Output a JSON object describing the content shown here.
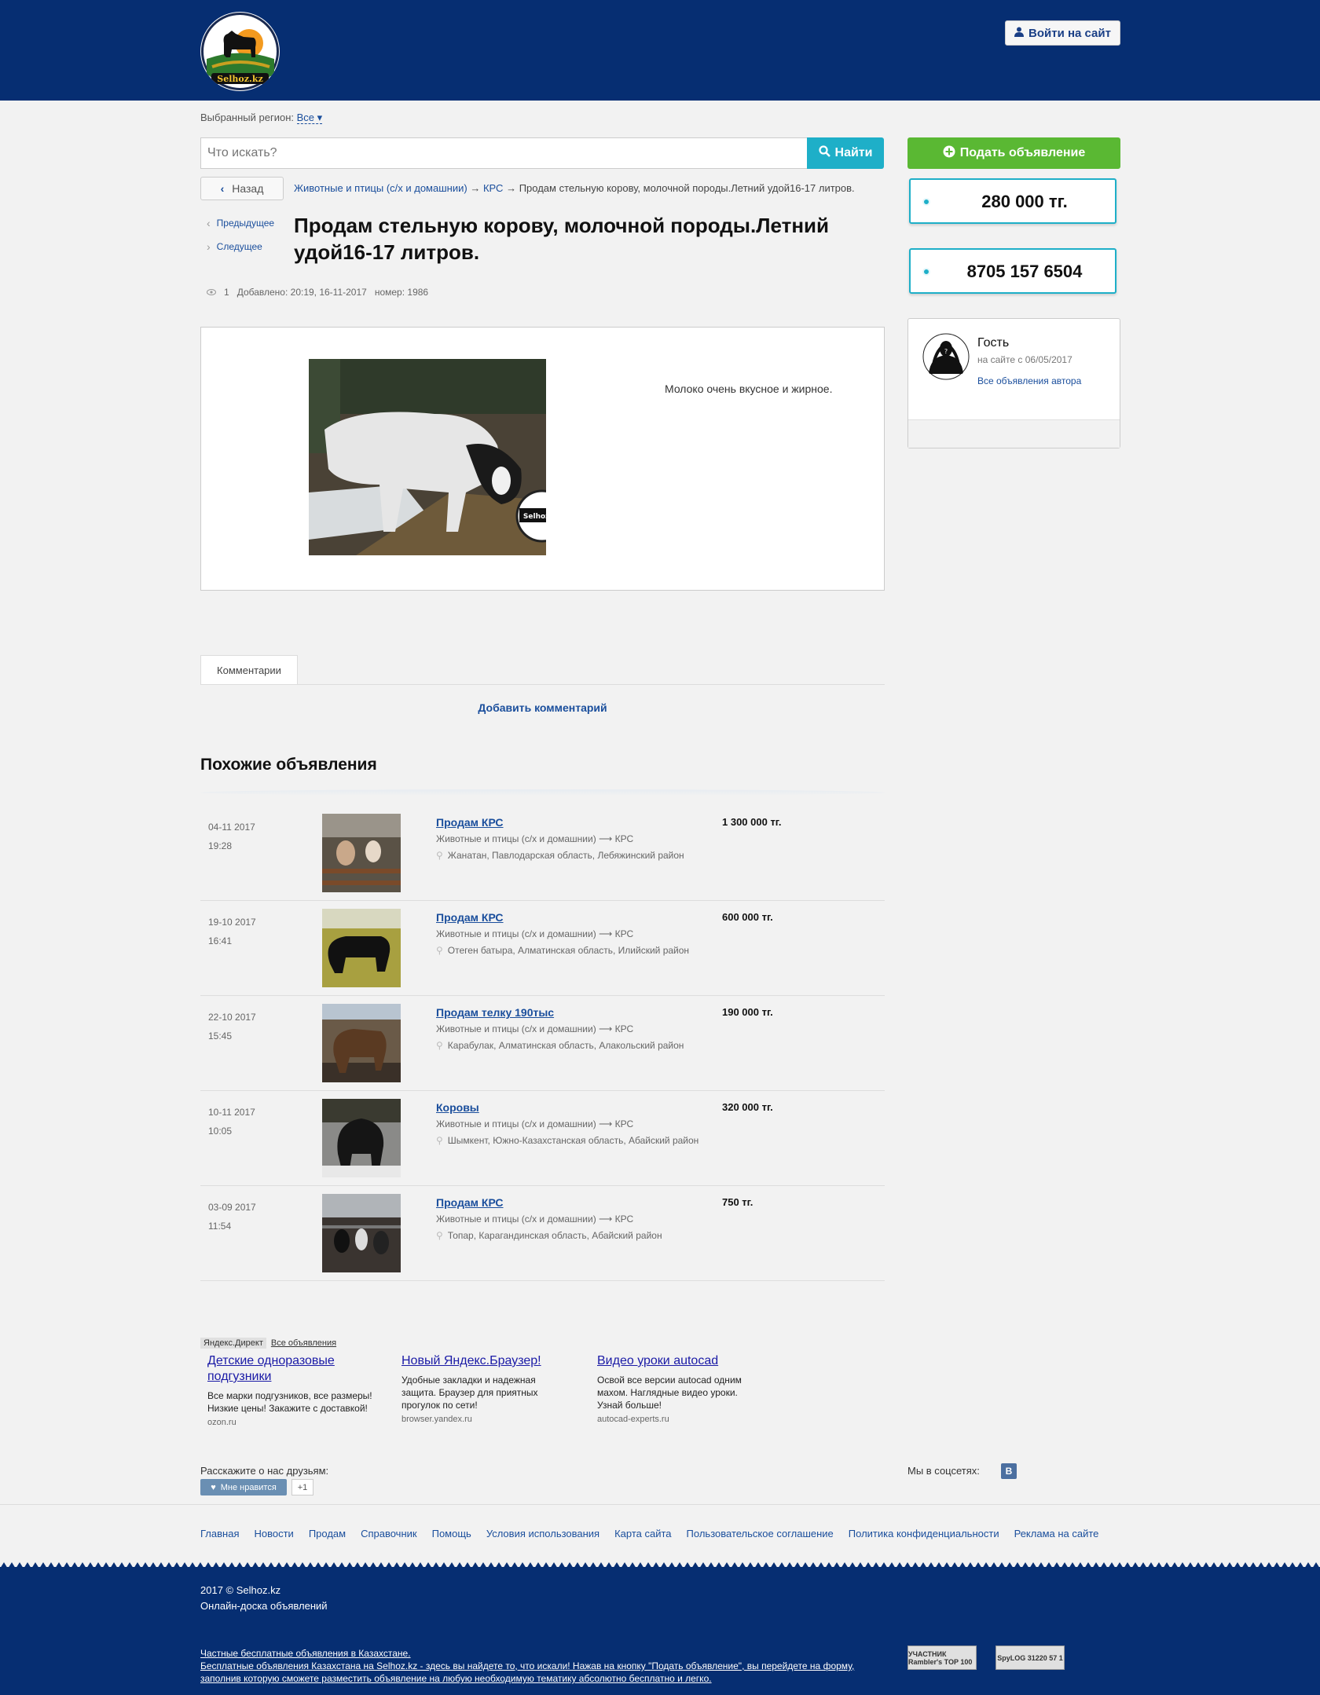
{
  "header": {
    "logo_text": "Selhoz.kz",
    "login_label": "Войти на сайт"
  },
  "region": {
    "label": "Выбранный регион:",
    "value": "Все"
  },
  "search": {
    "placeholder": "Что искать?",
    "button_label": "Найти"
  },
  "post_ad_label": "Подать объявление",
  "back_label": "Назад",
  "breadcrumb": {
    "level1": "Животные и птицы (с/х и домашнии)",
    "sep": "→",
    "level2": "КРС",
    "current": "Продам стельную корову, молочной породы.Летний удой16-17 литров."
  },
  "nav": {
    "prev": "Предыдущее",
    "next": "Следущее"
  },
  "listing": {
    "title": "Продам стельную корову, молочной породы.Летний удой16-17 литров.",
    "views": "1",
    "added": "Добавлено: 20:19, 16-11-2017",
    "number": "номер: 1986",
    "description": "Молоко очень вкусное и жирное.",
    "watermark": "Selhoz.kz",
    "price": "280 000 тг.",
    "phone": "8705 157 6504"
  },
  "author": {
    "name": "Гость",
    "since": "на сайте с 06/05/2017",
    "all_ads": "Все объявления автора"
  },
  "comments": {
    "tab": "Комментарии",
    "add": "Добавить комментарий"
  },
  "similar": {
    "title": "Похожие объявления",
    "items": [
      {
        "date": "04-11 2017",
        "time": "19:28",
        "title": "Продам КРС",
        "category": "Животные и птицы (с/х и домашнии) ⟶ КРС",
        "location": "Жанатан, Павлодарская область, Лебяжинский район",
        "price": "1 300 000 тг."
      },
      {
        "date": "19-10 2017",
        "time": "16:41",
        "title": "Продам КРС",
        "category": "Животные и птицы (с/х и домашнии) ⟶ КРС",
        "location": "Отеген батыра, Алматинская область, Илийский район",
        "price": "600 000 тг."
      },
      {
        "date": "22-10 2017",
        "time": "15:45",
        "title": "Продам телку 190тыс",
        "category": "Животные и птицы (с/х и домашнии) ⟶ КРС",
        "location": "Карабулак, Алматинская область, Алакольский район",
        "price": "190 000 тг."
      },
      {
        "date": "10-11 2017",
        "time": "10:05",
        "title": "Коровы",
        "category": "Животные и птицы (с/х и домашнии) ⟶ КРС",
        "location": "Шымкент, Южно-Казахстанская область, Абайский район",
        "price": "320 000 тг."
      },
      {
        "date": "03-09 2017",
        "time": "11:54",
        "title": "Продам КРС",
        "category": "Животные и птицы (с/х и домашнии) ⟶ КРС",
        "location": "Топар, Карагандинская область, Абайский район",
        "price": "750 тг."
      }
    ]
  },
  "ads": {
    "direct_label": "Яндекс.Директ",
    "all_label": "Все объявления",
    "items": [
      {
        "title": "Детские одноразовые подгузники",
        "text": "Все марки подгузников, все размеры! Низкие цены! Закажите с доставкой!",
        "url": "ozon.ru"
      },
      {
        "title": "Новый Яндекс.Браузер!",
        "text": "Удобные закладки и надежная защита. Браузер для приятных прогулок по сети!",
        "url": "browser.yandex.ru"
      },
      {
        "title": "Видео уроки autocad",
        "text": "Освой все версии autocad одним махом. Наглядные видео уроки. Узнай больше!",
        "url": "autocad-experts.ru"
      }
    ]
  },
  "share": {
    "label": "Расскажите о нас друзьям:",
    "like": "Мне нравится",
    "count": "+1",
    "social_label": "Мы в соцсетях:",
    "vk": "В"
  },
  "footer_nav": [
    "Главная",
    "Новости",
    "Продам",
    "Справочник",
    "Помощь",
    "Условия использования",
    "Карта сайта",
    "Пользовательское соглашение",
    "Политика конфиденциальности",
    "Реклама на сайте"
  ],
  "footer": {
    "copyright": "2017 © Selhoz.kz",
    "tagline": "Онлайн-доска объявлений",
    "text1": "Частные бесплатные объявления в Казахстане.",
    "text2": "Бесплатные объявления Казахстана на Selhoz.kz - здесь вы найдете то, что искали! Нажав на кнопку \"Подать объявление\", вы перейдете на форму,",
    "text3": "заполнив которую сможете разместить объявление на любую необходимую тематику абсолютно бесплатно и легко.",
    "counter1": "УЧАСТНИК Rambler's TOP 100",
    "counter2": "SpyLOG 31220 57 1"
  },
  "colors": {
    "header_bg": "#062e72",
    "accent": "#1eafc8",
    "green": "#5ab833",
    "link": "#1a4e9c"
  }
}
